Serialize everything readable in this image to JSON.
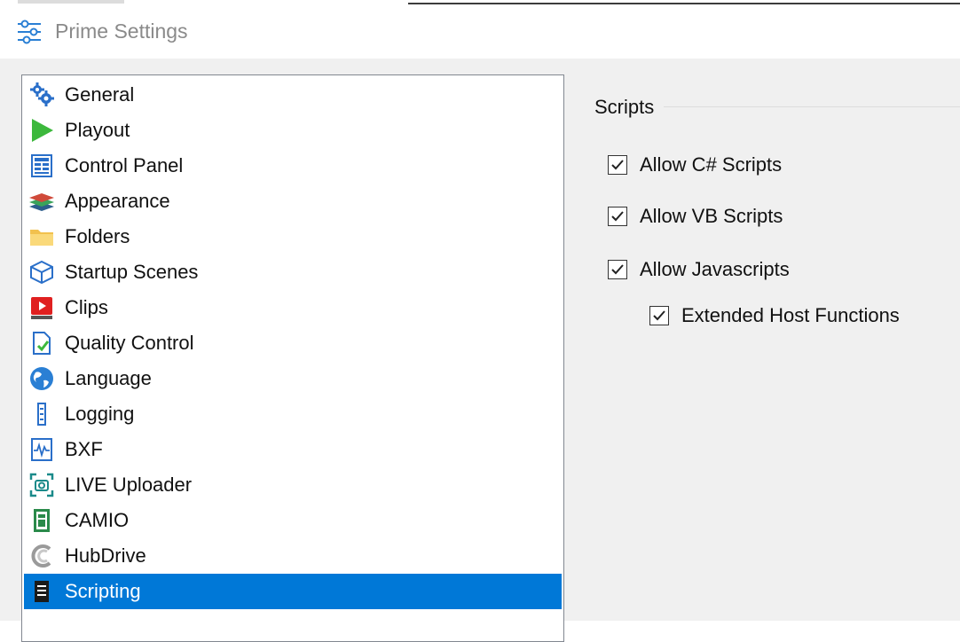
{
  "window": {
    "title": "Prime Settings"
  },
  "nav": {
    "items": [
      {
        "label": "General",
        "icon": "gears-icon"
      },
      {
        "label": "Playout",
        "icon": "play-icon"
      },
      {
        "label": "Control Panel",
        "icon": "control-panel-icon"
      },
      {
        "label": "Appearance",
        "icon": "layers-icon"
      },
      {
        "label": "Folders",
        "icon": "folder-icon"
      },
      {
        "label": "Startup Scenes",
        "icon": "cube-icon"
      },
      {
        "label": "Clips",
        "icon": "video-clip-icon"
      },
      {
        "label": "Quality Control",
        "icon": "document-check-icon"
      },
      {
        "label": "Language",
        "icon": "globe-icon"
      },
      {
        "label": "Logging",
        "icon": "log-icon"
      },
      {
        "label": "BXF",
        "icon": "waveform-icon"
      },
      {
        "label": "LIVE Uploader",
        "icon": "camera-focus-icon"
      },
      {
        "label": "CAMIO",
        "icon": "camio-icon"
      },
      {
        "label": "HubDrive",
        "icon": "hubdrive-icon"
      },
      {
        "label": "Scripting",
        "icon": "script-icon"
      }
    ],
    "selected": "Scripting"
  },
  "scripts_group": {
    "label": "Scripts",
    "options": [
      {
        "label": "Allow C# Scripts",
        "checked": true
      },
      {
        "label": "Allow VB Scripts",
        "checked": true
      },
      {
        "label": "Allow Javascripts",
        "checked": true
      },
      {
        "label": "Extended Host Functions",
        "checked": true
      }
    ]
  },
  "colors": {
    "selection": "#0078d7",
    "panel_bg": "#f0f0f0"
  }
}
